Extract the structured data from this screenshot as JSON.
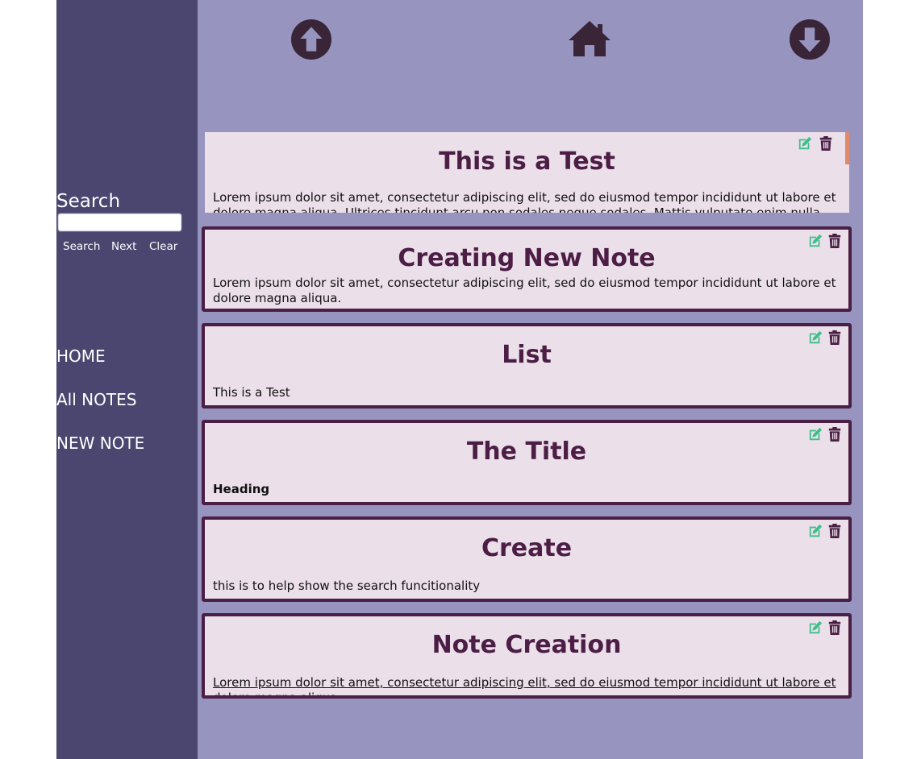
{
  "sidebar": {
    "search_title": "Search",
    "search_placeholder": "",
    "search_value": "",
    "buttons": {
      "search": "Search",
      "next": "Next",
      "clear": "Clear"
    },
    "nav": [
      {
        "label": "HOME"
      },
      {
        "label": "All NOTES"
      },
      {
        "label": "NEW NOTE"
      }
    ]
  },
  "topbar": {
    "icons": [
      "arrow-up-circle-icon",
      "home-icon",
      "arrow-down-circle-icon"
    ]
  },
  "notes": [
    {
      "title": "This is a Test",
      "body": "Lorem ipsum dolor sit amet, consectetur adipiscing elit, sed do eiusmod tempor incididunt ut labore et dolore magna aliqua. Ultrices tincidunt arcu non sodales neque sodales. Mattis vulputate enim nulla aliquet"
    },
    {
      "title": "Creating New Note",
      "body": "Lorem ipsum dolor sit amet, consectetur adipiscing elit, sed do eiusmod tempor incididunt ut labore et dolore magna aliqua."
    },
    {
      "title": "List",
      "body": "This is a Test"
    },
    {
      "title": "The Title",
      "body": "Heading"
    },
    {
      "title": "Create",
      "body": "this is to help show the search funcitionality"
    },
    {
      "title": "Note Creation",
      "body": "Lorem ipsum dolor sit amet, consectetur adipiscing elit, sed do eiusmod tempor incididunt ut labore et dolore magna aliqua."
    }
  ],
  "colors": {
    "sidebar_bg": "#4a4670",
    "main_bg": "#9795bf",
    "note_bg": "#ebdfe9",
    "note_border": "#4a1f45",
    "title_color": "#4c1d45",
    "edit_icon": "#3dbf8a",
    "trash_icon": "#4a1f45",
    "scroll_accent": "#e08a6a"
  }
}
